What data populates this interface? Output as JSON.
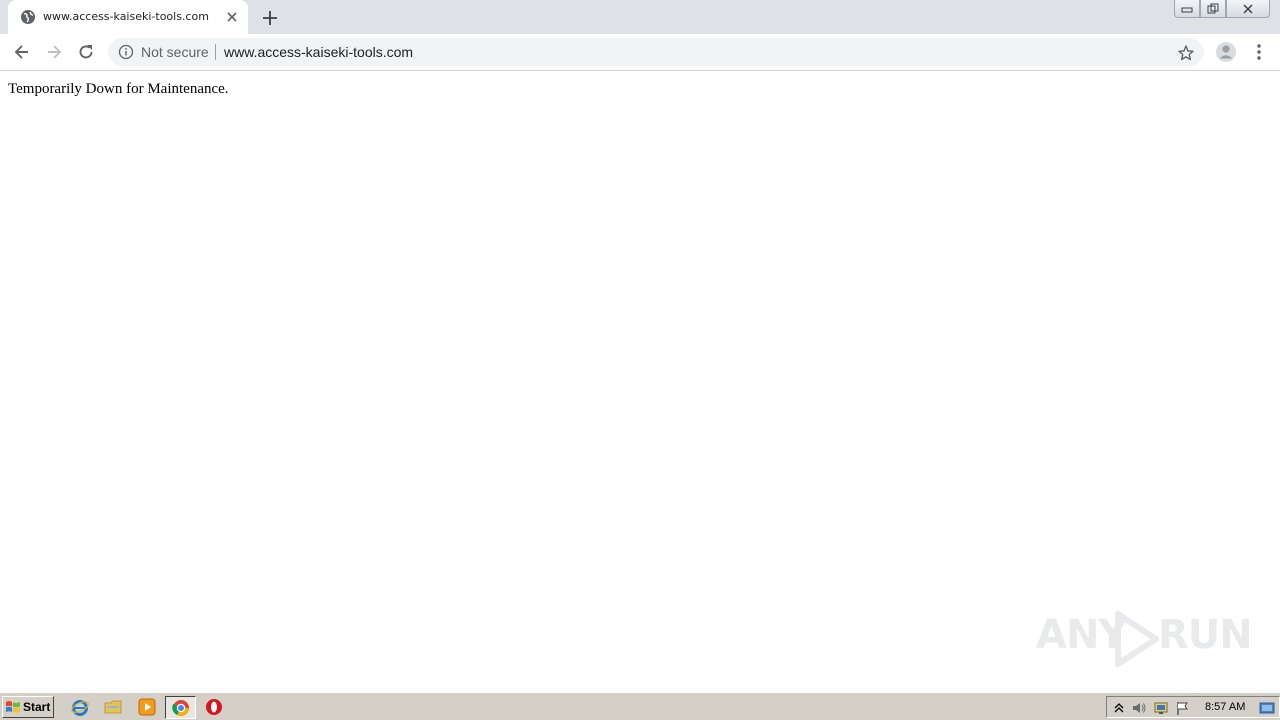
{
  "browser": {
    "tab": {
      "title": "www.access-kaiseki-tools.com",
      "favicon": "globe-icon"
    },
    "omnibox": {
      "security_label": "Not secure",
      "url": "www.access-kaiseki-tools.com"
    }
  },
  "page": {
    "message": "Temporarily Down for Maintenance."
  },
  "watermark": {
    "left_text": "ANY",
    "right_text": "RUN"
  },
  "taskbar": {
    "start_label": "Start",
    "apps": [
      "internet-explorer-icon",
      "file-explorer-icon",
      "media-player-icon",
      "chrome-icon",
      "opera-icon"
    ],
    "clock": "8:57 AM"
  },
  "colors": {
    "tabstrip": "#dee1e6",
    "omnibox": "#f1f3f4",
    "taskbar": "#d4d0c8"
  }
}
